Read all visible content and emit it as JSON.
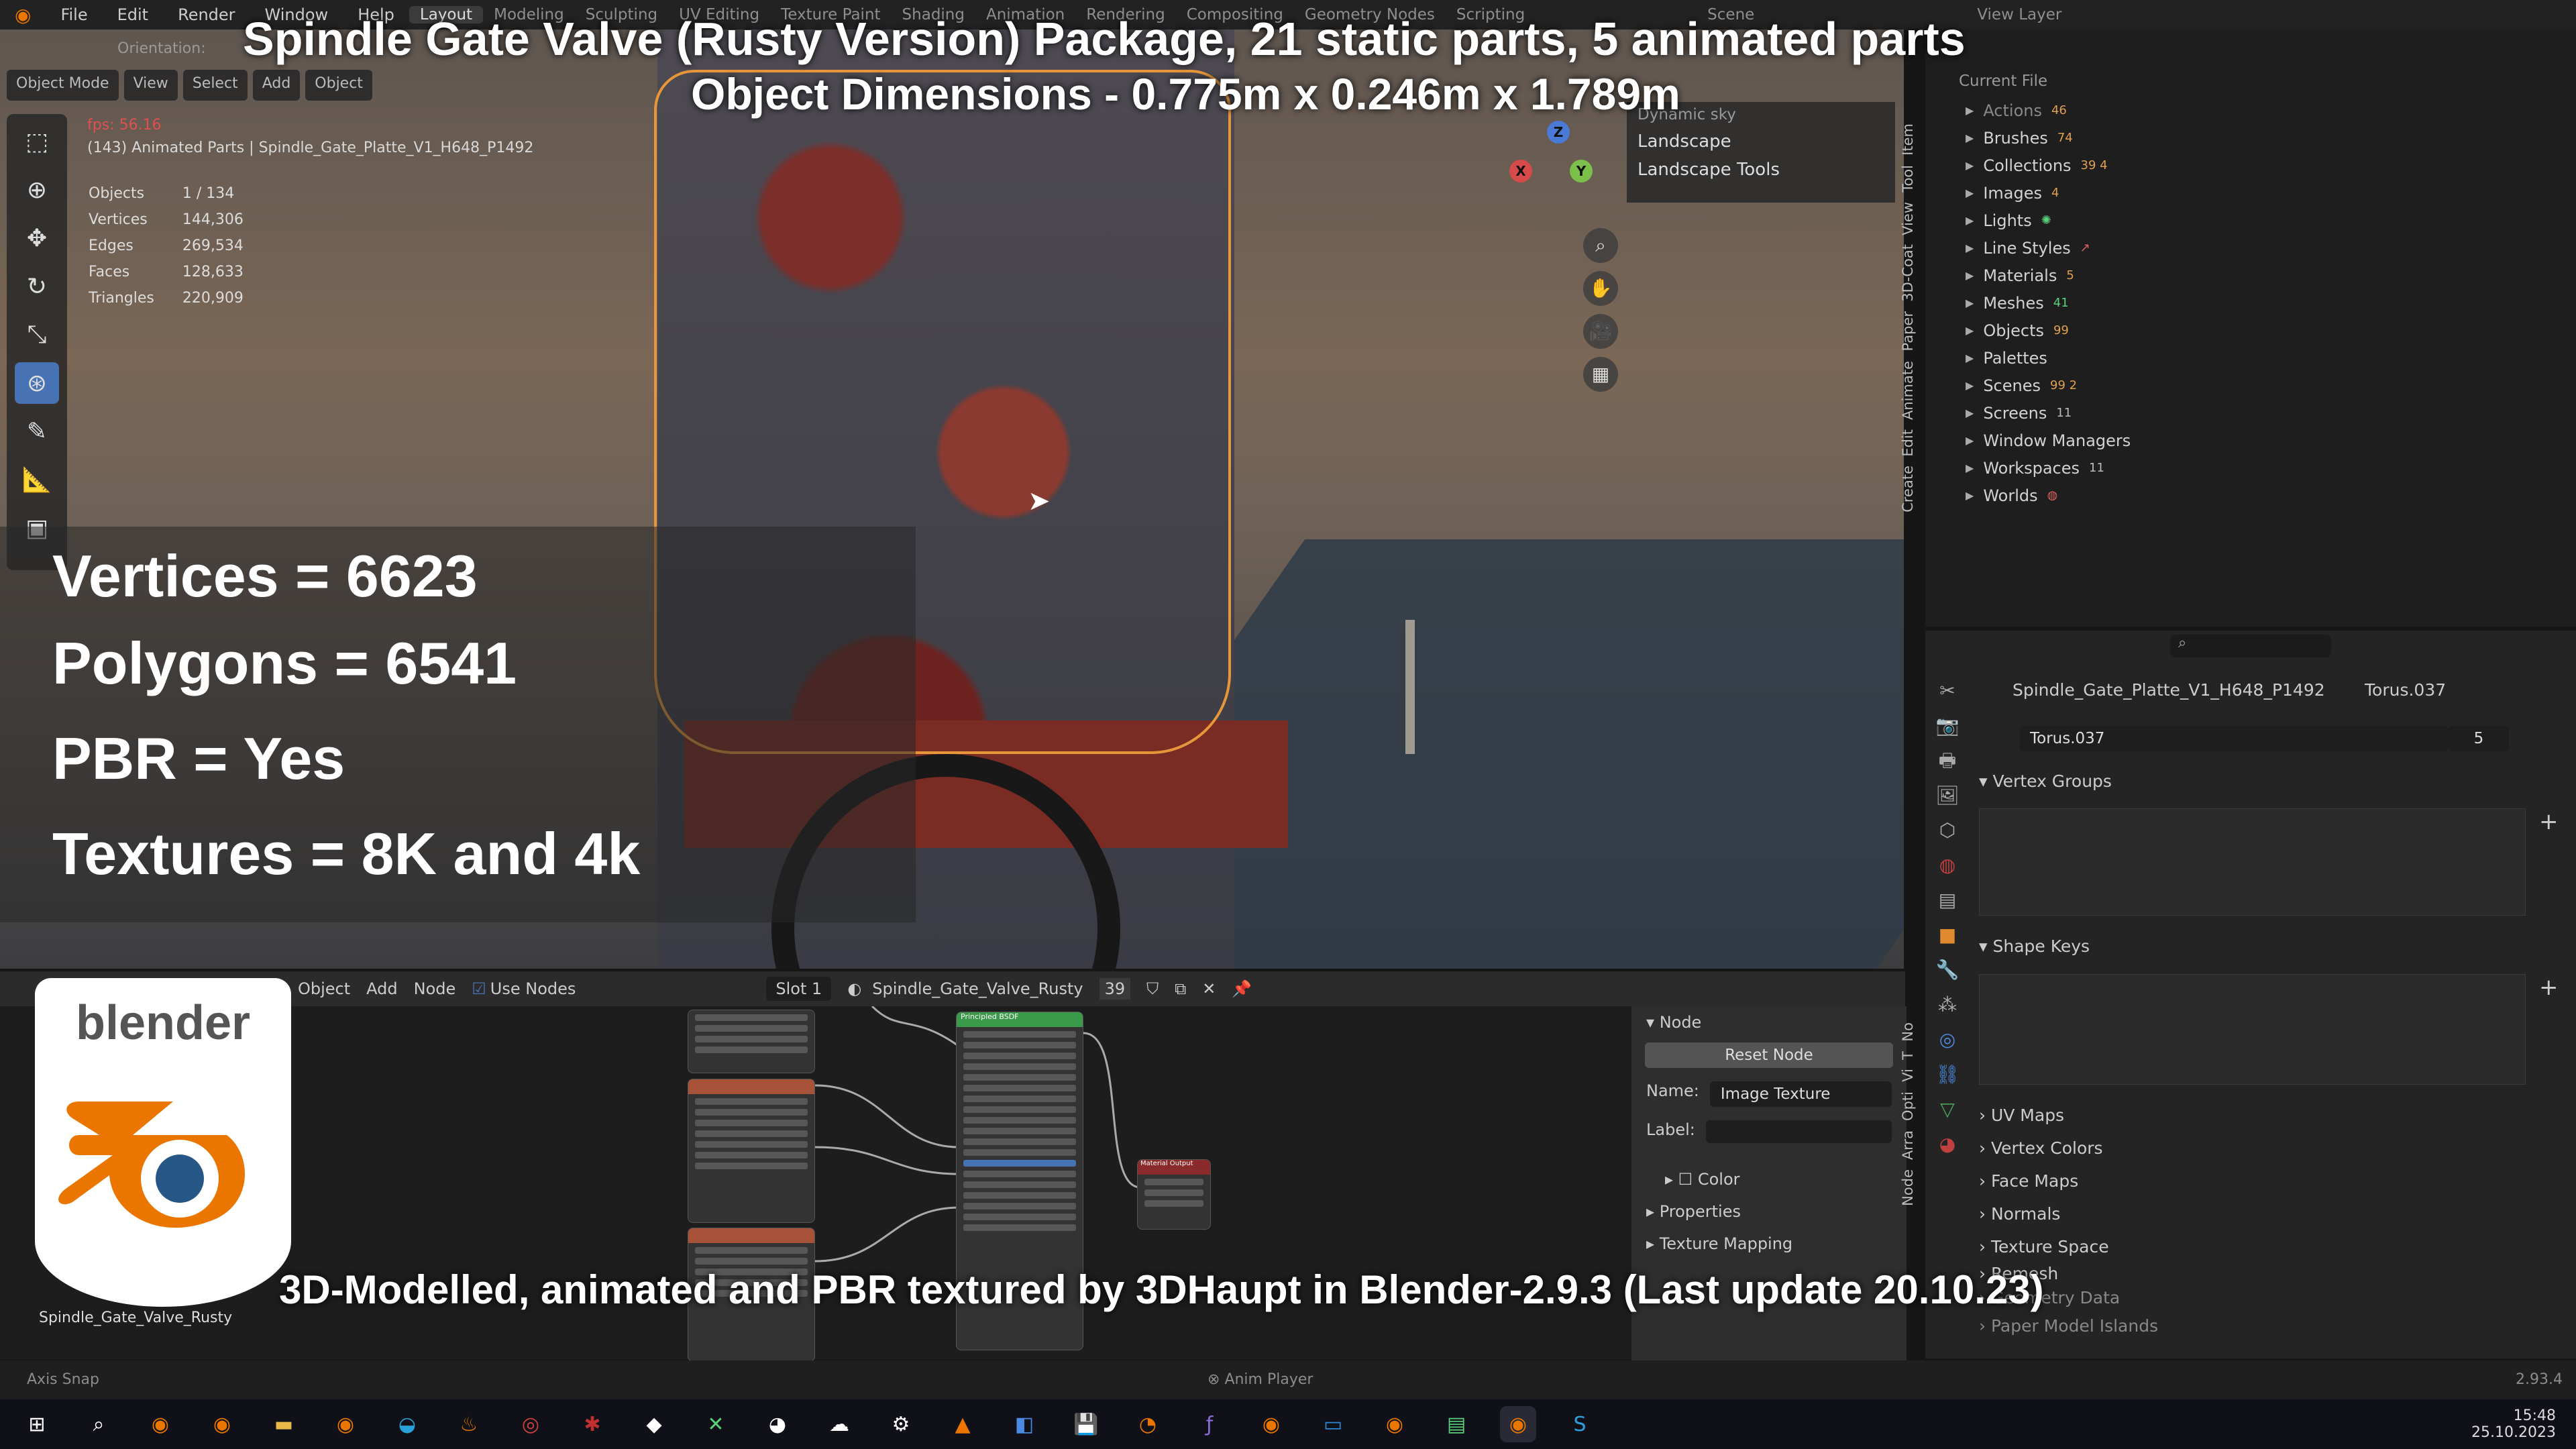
{
  "topbar": {
    "menus": [
      "File",
      "Edit",
      "Render",
      "Window",
      "Help"
    ],
    "workspaces": [
      "Layout",
      "Modeling",
      "Sculpting",
      "UV Editing",
      "Texture Paint",
      "Shading",
      "Animation",
      "Rendering",
      "Compositing",
      "Geometry Nodes",
      "Scripting"
    ],
    "active_workspace": "Layout",
    "scene": "Scene",
    "view_layer": "View Layer"
  },
  "viewport": {
    "orientation_label": "Orientation:",
    "mode": "Object Mode",
    "header_buttons": [
      "View",
      "Select",
      "Add",
      "Object"
    ],
    "fps": "fps: 56.16",
    "object_path": "(143) Animated Parts | Spindle_Gate_Platte_V1_H648_P1492",
    "stats": [
      {
        "label": "Objects",
        "value": "1 / 134"
      },
      {
        "label": "Vertices",
        "value": "144,306"
      },
      {
        "label": "Edges",
        "value": "269,534"
      },
      {
        "label": "Faces",
        "value": "128,633"
      },
      {
        "label": "Triangles",
        "value": "220,909"
      }
    ],
    "npanel_items": [
      "Dynamic sky",
      "Landscape",
      "Landscape Tools"
    ],
    "side_tabs": [
      "Item",
      "Tool",
      "View",
      "3D-Coat",
      "Paper",
      "Animate",
      "Edit",
      "Create"
    ],
    "gizmo_axes": [
      "X",
      "Y",
      "Z"
    ]
  },
  "overlay": {
    "title": "Spindle Gate Valve (Rusty Version) Package, 21 static parts, 5 animated parts",
    "dimensions": "Object Dimensions -  0.775m x 0.246m x 1.789m",
    "vertices": "Vertices = 6623",
    "polygons": "Polygons = 6541",
    "pbr": "PBR =  Yes",
    "textures": "Textures = 8K and 4k",
    "credit": "3D-Modelled, animated and PBR textured by 3DHaupt in Blender-2.9.3 (Last update 20.10.23)"
  },
  "outliner": {
    "header": "Current File",
    "rows": [
      {
        "label": "Actions",
        "badge": "46"
      },
      {
        "label": "Brushes",
        "badge": "74"
      },
      {
        "label": "Collections",
        "badge": "39 4"
      },
      {
        "label": "Images",
        "badge": "4"
      },
      {
        "label": "Lights",
        "badge": ""
      },
      {
        "label": "Line Styles",
        "badge": ""
      },
      {
        "label": "Materials",
        "badge": "5"
      },
      {
        "label": "Meshes",
        "badge": "41"
      },
      {
        "label": "Objects",
        "badge": "99"
      },
      {
        "label": "Palettes",
        "badge": ""
      },
      {
        "label": "Scenes",
        "badge": "99 2"
      },
      {
        "label": "Screens",
        "badge": "11"
      },
      {
        "label": "Window Managers",
        "badge": ""
      },
      {
        "label": "Workspaces",
        "badge": "11"
      },
      {
        "label": "Worlds",
        "badge": ""
      }
    ]
  },
  "properties": {
    "object_name": "Spindle_Gate_Platte_V1_H648_P1492",
    "mesh_name": "Torus.037",
    "mesh_field": "Torus.037",
    "users": "5",
    "vertex_groups": "Vertex Groups",
    "shape_keys": "Shape Keys",
    "collapsed_sections": [
      "UV Maps",
      "Vertex Colors",
      "Face Maps",
      "Normals",
      "Texture Space",
      "Remesh",
      "Geometry Data",
      "Paper Model Islands"
    ]
  },
  "node_editor": {
    "menus": [
      "Object",
      "Add",
      "Node"
    ],
    "use_nodes": "Use Nodes",
    "slot": "Slot 1",
    "material": "Spindle_Gate_Valve_Rusty",
    "user_count": "39",
    "material_label": "Spindle_Gate_Valve_Rusty",
    "side_title": "Node",
    "reset_node": "Reset Node",
    "name_label": "Name:",
    "name_value": "Image Texture",
    "label_label": "Label:",
    "label_value": "",
    "color": "Color",
    "properties": "Properties",
    "texture_mapping": "Texture Mapping",
    "side_tabs": [
      "No",
      "T",
      "Vi",
      "Opti",
      "Arra",
      "Node"
    ],
    "principled_title": "Principled BSDF",
    "output_title": "Material Output"
  },
  "logo": {
    "text": "blender"
  },
  "statusbar": {
    "left": "Axis Snap",
    "center": "Anim Player",
    "version": "2.93.4"
  },
  "taskbar": {
    "time": "15:48",
    "date": "25.10.2023"
  },
  "colors": {
    "accent": "#4772b3",
    "selection": "#e8963a",
    "blender_orange": "#ea7600",
    "blender_blue": "#265787"
  }
}
